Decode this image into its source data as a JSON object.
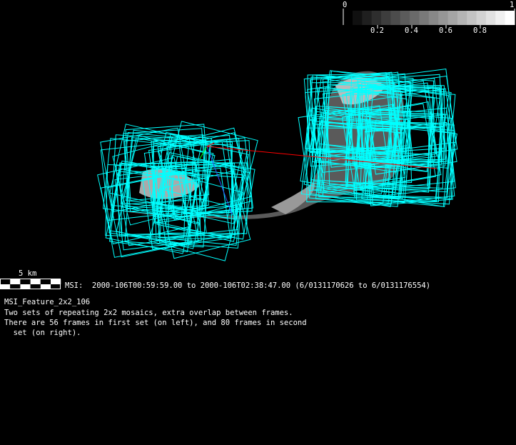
{
  "colorbar": {
    "min_label": "0",
    "max_label": "1",
    "tick_labels": [
      "0.2",
      "0.4",
      "0.6",
      "0.8"
    ],
    "steps": 17
  },
  "scale_bar": {
    "label": "5 km"
  },
  "time_range": "MSI:  2000-106T00:59:59.00 to 2000-106T02:38:47.00 (6/0131170626 to 6/0131176554)",
  "description": {
    "title": "MSI_Feature_2x2_106",
    "lines": [
      "Two sets of repeating 2x2 mosaics, extra overlap between frames.",
      "There are 56 frames in first set (on left), and 80 frames in second",
      "  set (on right)."
    ]
  },
  "frame_sets": [
    {
      "name": "first set",
      "frames": 56
    },
    {
      "name": "second set",
      "frames": 80
    }
  ],
  "colors": {
    "frame": "#00ffff",
    "track": "#ff0000",
    "background": "#000000"
  }
}
